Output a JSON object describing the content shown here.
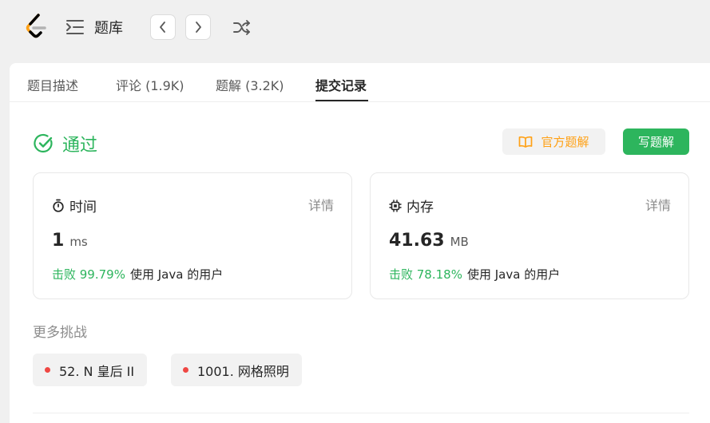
{
  "topbar": {
    "title": "题库",
    "icons": {
      "logo": "leetcode-logo",
      "list": "list-indent-icon",
      "prev": "chevron-left-icon",
      "next": "chevron-right-icon",
      "shuffle": "shuffle-icon"
    }
  },
  "tabs": [
    {
      "label": "题目描述"
    },
    {
      "label": "评论 (1.9K)"
    },
    {
      "label": "题解 (3.2K)"
    },
    {
      "label": "提交记录",
      "active": true
    }
  ],
  "result": {
    "status": "通过",
    "official_solution_label": "官方题解",
    "write_solution_label": "写题解"
  },
  "time_card": {
    "title": "时间",
    "detail_label": "详情",
    "value": "1",
    "unit": "ms",
    "beat": "击败 99.79%",
    "rest": "使用 Java 的用户"
  },
  "memory_card": {
    "title": "内存",
    "detail_label": "详情",
    "value": "41.63",
    "unit": "MB",
    "beat": "击败 78.18%",
    "rest": "使用 Java 的用户"
  },
  "more": {
    "title": "更多挑战",
    "items": [
      {
        "label": "52. N 皇后 II"
      },
      {
        "label": "1001. 网格照明"
      }
    ]
  },
  "colors": {
    "accept_green": "#2db55d",
    "official_orange": "#ffa116",
    "hard_red": "#ef4743"
  }
}
